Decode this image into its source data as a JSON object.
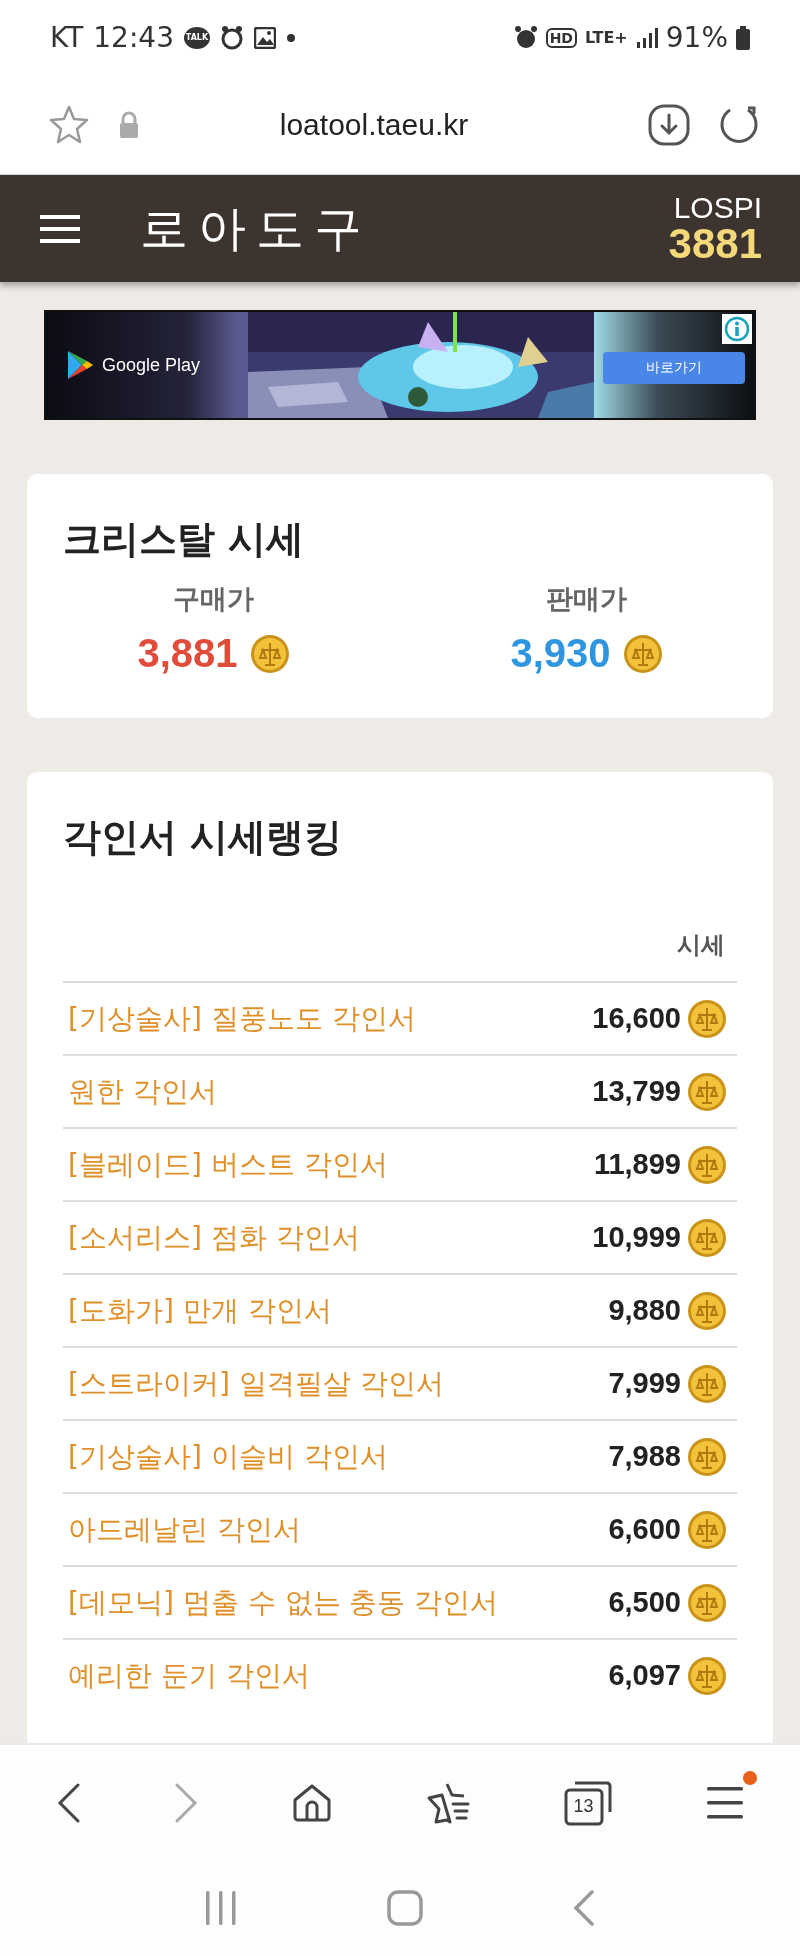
{
  "status_bar": {
    "carrier": "KT",
    "time": "12:43",
    "talk_badge": "TALK",
    "hd": "HD",
    "network": "LTE+",
    "battery": "91%"
  },
  "browser": {
    "url": "loatool.taeu.kr"
  },
  "header": {
    "logo": "로아도구",
    "index_label": "LOSPI",
    "index_value": "3881"
  },
  "ad": {
    "brand": "Google Play",
    "button": "바로가기"
  },
  "crystal": {
    "title": "크리스탈 시세",
    "prices": [
      {
        "label": "구매가",
        "value": "3,881",
        "kind": "buy"
      },
      {
        "label": "판매가",
        "value": "3,930",
        "kind": "sell"
      }
    ]
  },
  "ranking": {
    "title": "각인서 시세랭킹",
    "column": "시세",
    "rows": [
      {
        "name": "[기상술사] 질풍노도 각인서",
        "price": "16,600"
      },
      {
        "name": "원한 각인서",
        "price": "13,799"
      },
      {
        "name": "[블레이드] 버스트 각인서",
        "price": "11,899"
      },
      {
        "name": "[소서리스] 점화 각인서",
        "price": "10,999"
      },
      {
        "name": "[도화가] 만개 각인서",
        "price": "9,880"
      },
      {
        "name": "[스트라이커] 일격필살 각인서",
        "price": "7,999"
      },
      {
        "name": "[기상술사] 이슬비 각인서",
        "price": "7,988"
      },
      {
        "name": "아드레날린 각인서",
        "price": "6,600"
      },
      {
        "name": "[데모닉] 멈출 수 없는 충동 각인서",
        "price": "6,500"
      },
      {
        "name": "예리한 둔기 각인서",
        "price": "6,097"
      }
    ]
  },
  "bottom_bar": {
    "tab_count": "13",
    "menu_notification": true
  }
}
